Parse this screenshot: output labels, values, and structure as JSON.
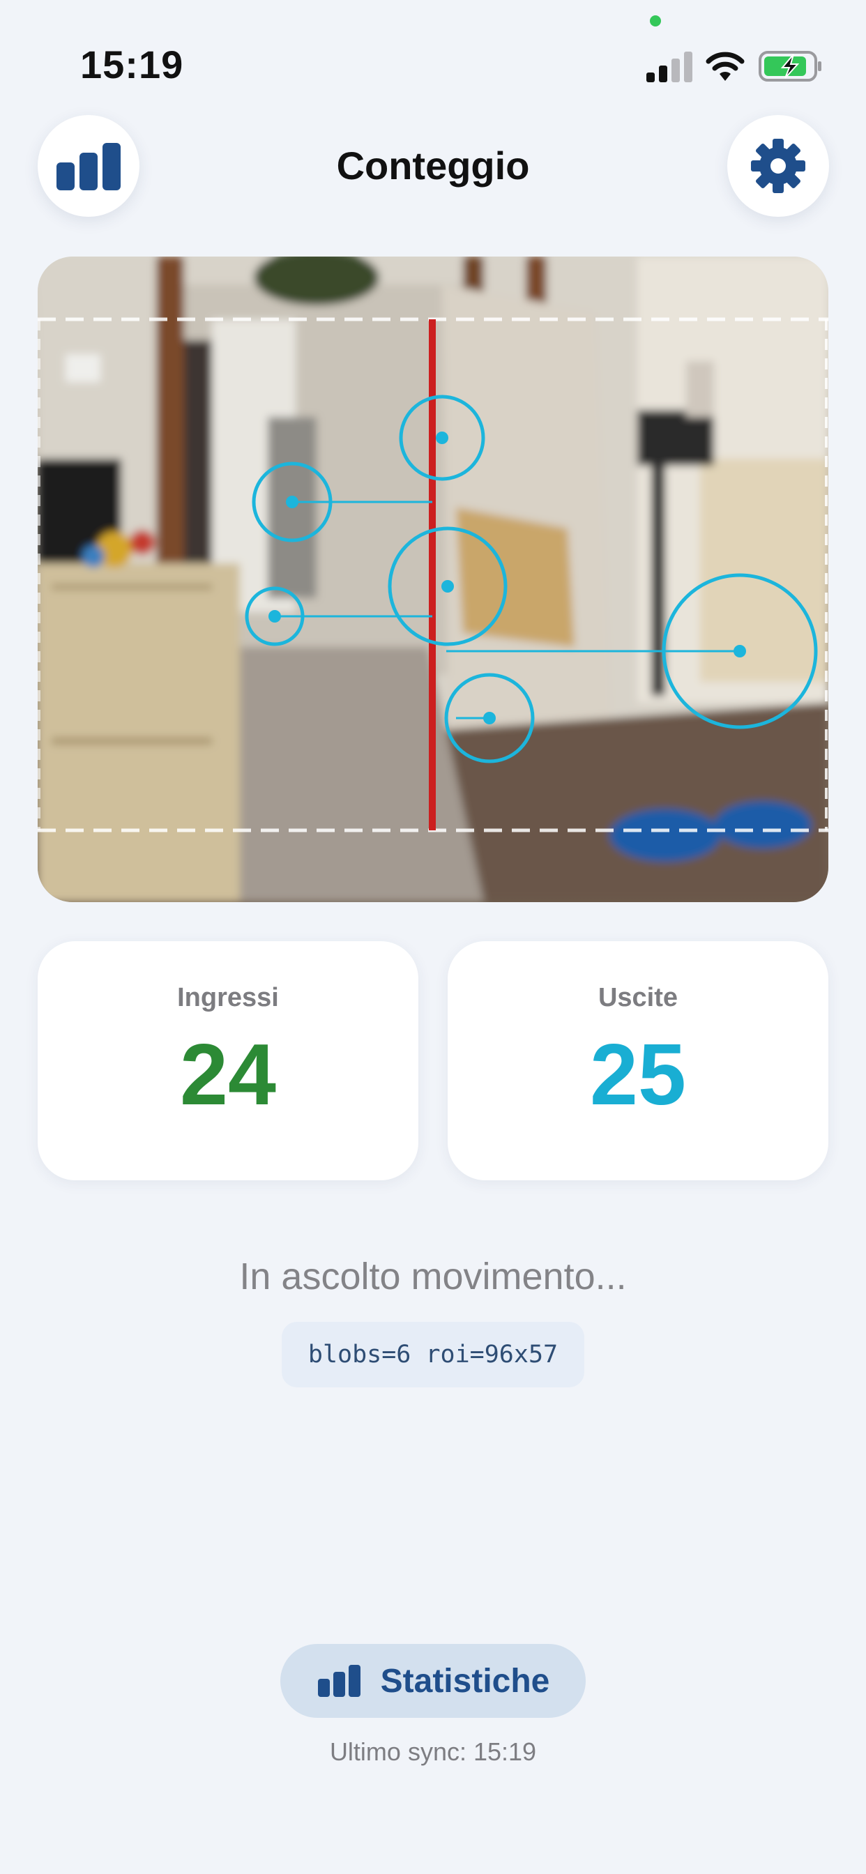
{
  "status_bar": {
    "time": "15:19",
    "icons": [
      "cellular-signal-icon",
      "wifi-icon",
      "battery-charging-icon"
    ]
  },
  "header": {
    "title": "Conteggio",
    "left_button_icon": "bar-chart-icon",
    "right_button_icon": "gear-icon"
  },
  "camera": {
    "overlay_color": "#1cb5dc",
    "line_color": "#cc1f1f"
  },
  "counts": {
    "in_label": "Ingressi",
    "in_value": "24",
    "in_color": "#2c8a35",
    "out_label": "Uscite",
    "out_value": "25",
    "out_color": "#19aed3"
  },
  "status": {
    "message": "In ascolto movimento...",
    "debug": "blobs=6 roi=96x57"
  },
  "footer": {
    "stats_button_label": "Statistiche",
    "stats_button_icon": "bar-chart-icon",
    "sync": "Ultimo sync: 15:19"
  }
}
